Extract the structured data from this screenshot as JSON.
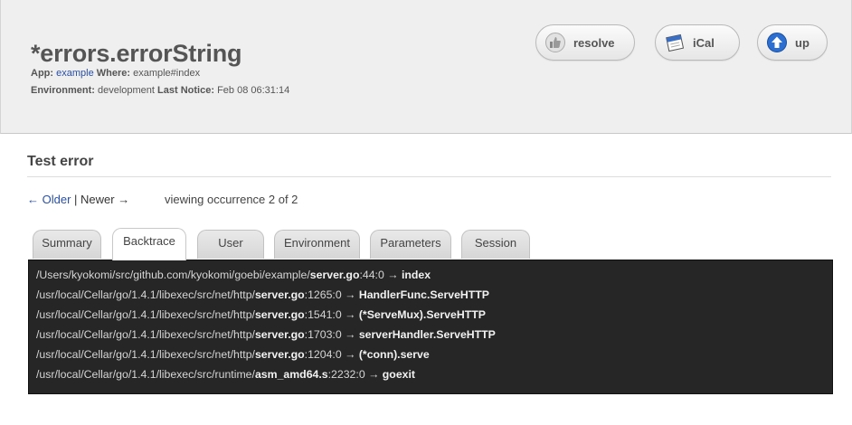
{
  "header": {
    "title": "*errors.errorString",
    "app_label": "App:",
    "app_value": "example",
    "where_label": "Where:",
    "where_value": "example#index",
    "env_label": "Environment:",
    "env_value": "development",
    "last_notice_label": "Last Notice:",
    "last_notice_value": "Feb 08 06:31:14"
  },
  "actions": {
    "resolve": "resolve",
    "ical": "iCal",
    "up": "up"
  },
  "section": {
    "title": "Test error"
  },
  "pager": {
    "older": "← Older",
    "sep": "|",
    "newer": "Newer →",
    "occurrence": "viewing occurrence 2 of 2"
  },
  "tabs": [
    {
      "label": "Summary",
      "active": false
    },
    {
      "label": "Backtrace",
      "active": true
    },
    {
      "label": "User",
      "active": false
    },
    {
      "label": "Environment",
      "active": false
    },
    {
      "label": "Parameters",
      "active": false
    },
    {
      "label": "Session",
      "active": false
    }
  ],
  "backtrace": [
    {
      "path": "/Users/kyokomi/src/github.com/kyokomi/goebi/example/",
      "file": "server.go",
      "loc": ":44:0 → ",
      "func": "index"
    },
    {
      "path": "/usr/local/Cellar/go/1.4.1/libexec/src/net/http/",
      "file": "server.go",
      "loc": ":1265:0 → ",
      "func": "HandlerFunc.ServeHTTP"
    },
    {
      "path": "/usr/local/Cellar/go/1.4.1/libexec/src/net/http/",
      "file": "server.go",
      "loc": ":1541:0 → ",
      "func": "(*ServeMux).ServeHTTP"
    },
    {
      "path": "/usr/local/Cellar/go/1.4.1/libexec/src/net/http/",
      "file": "server.go",
      "loc": ":1703:0 → ",
      "func": "serverHandler.ServeHTTP"
    },
    {
      "path": "/usr/local/Cellar/go/1.4.1/libexec/src/net/http/",
      "file": "server.go",
      "loc": ":1204:0 → ",
      "func": "(*conn).serve"
    },
    {
      "path": "/usr/local/Cellar/go/1.4.1/libexec/src/runtime/",
      "file": "asm_amd64.s",
      "loc": ":2232:0 → ",
      "func": "goexit"
    }
  ]
}
